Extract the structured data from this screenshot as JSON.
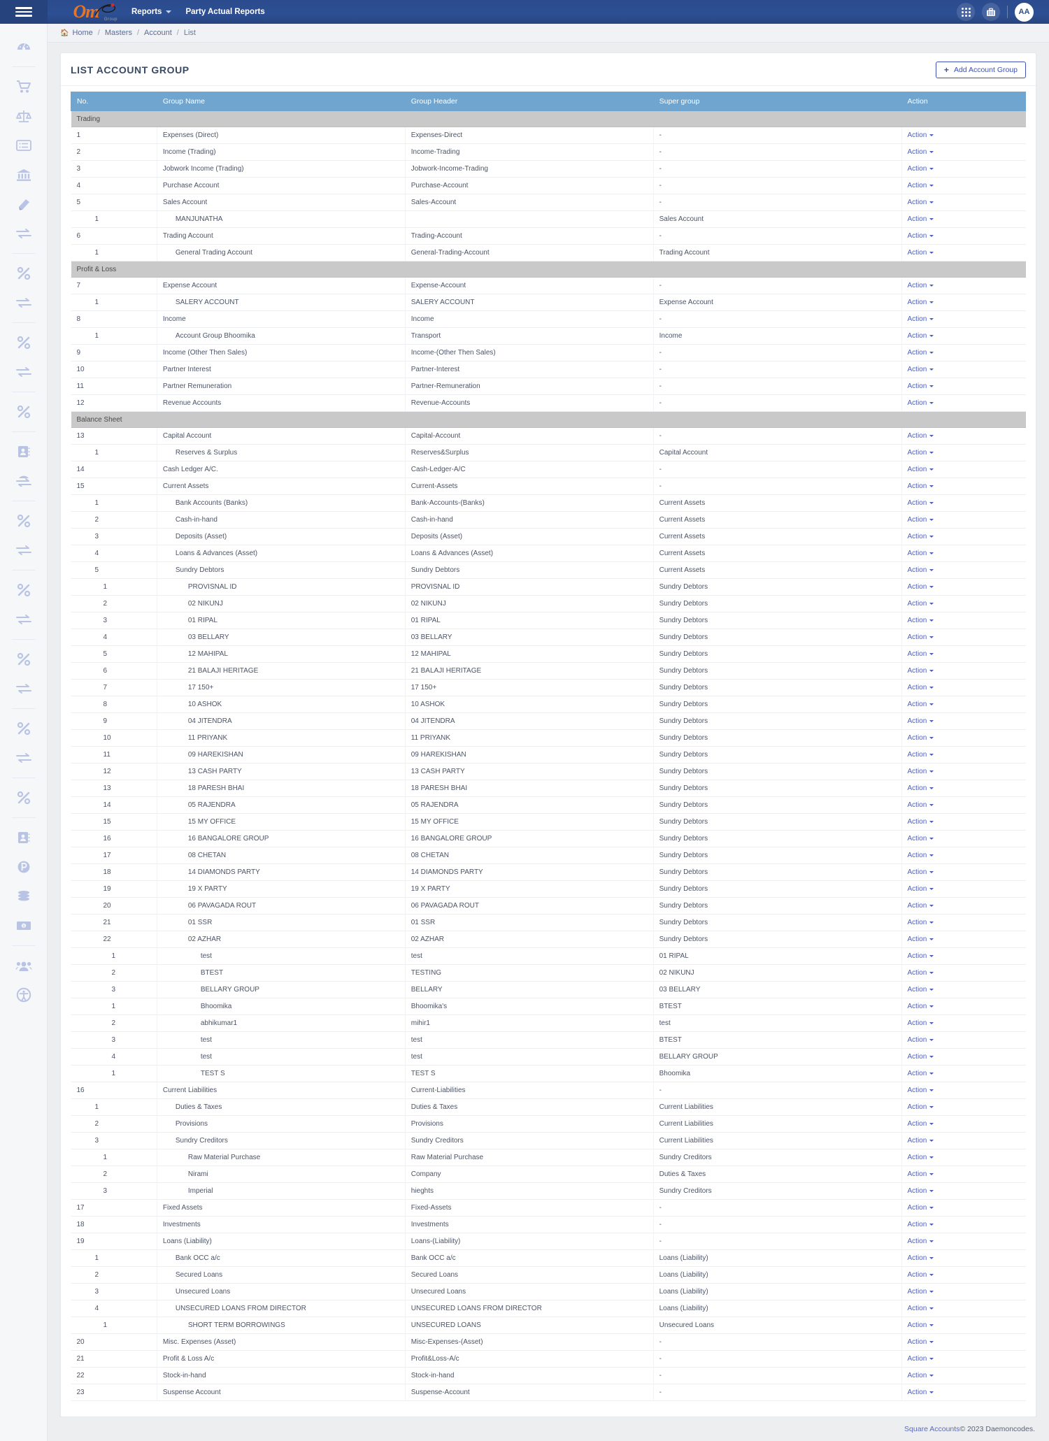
{
  "topbar": {
    "menu_icon": "hamburger-icon",
    "logo_text": "Om",
    "logo_sub": "Group",
    "nav": [
      {
        "label": "Reports",
        "has_caret": true
      },
      {
        "label": "Party Actual Reports",
        "has_caret": false
      }
    ],
    "icons": [
      "apps-grid-icon",
      "briefcase-icon"
    ],
    "avatar_initials": "AA"
  },
  "breadcrumb": {
    "home": "Home",
    "items": [
      "Masters",
      "Account",
      "List"
    ],
    "separator": "/"
  },
  "card": {
    "title": "LIST ACCOUNT GROUP",
    "add_button": "Add Account Group",
    "add_button_icon": "plus-icon"
  },
  "table": {
    "columns": [
      "No.",
      "Group Name",
      "Group Header",
      "Super group",
      "Action"
    ],
    "action_label": "Action",
    "empty_value": "-",
    "rows": [
      {
        "type": "section",
        "label": "Trading"
      },
      {
        "no": "1",
        "level": 0,
        "name": "Expenses (Direct)",
        "header": "Expenses-Direct",
        "super": "-"
      },
      {
        "no": "2",
        "level": 0,
        "name": "Income (Trading)",
        "header": "Income-Trading",
        "super": "-"
      },
      {
        "no": "3",
        "level": 0,
        "name": "Jobwork Income (Trading)",
        "header": "Jobwork-Income-Trading",
        "super": "-"
      },
      {
        "no": "4",
        "level": 0,
        "name": "Purchase Account",
        "header": "Purchase-Account",
        "super": "-"
      },
      {
        "no": "5",
        "level": 0,
        "name": "Sales Account",
        "header": "Sales-Account",
        "super": "-"
      },
      {
        "no": "1",
        "level": 1,
        "name": "MANJUNATHA",
        "header": "",
        "super": "Sales Account"
      },
      {
        "no": "6",
        "level": 0,
        "name": "Trading Account",
        "header": "Trading-Account",
        "super": "-"
      },
      {
        "no": "1",
        "level": 1,
        "name": "General Trading Account",
        "header": "General-Trading-Account",
        "super": "Trading Account"
      },
      {
        "type": "section",
        "label": "Profit & Loss"
      },
      {
        "no": "7",
        "level": 0,
        "name": "Expense Account",
        "header": "Expense-Account",
        "super": "-"
      },
      {
        "no": "1",
        "level": 1,
        "name": "SALERY ACCOUNT",
        "header": "SALERY ACCOUNT",
        "super": "Expense Account"
      },
      {
        "no": "8",
        "level": 0,
        "name": "Income",
        "header": "Income",
        "super": "-"
      },
      {
        "no": "1",
        "level": 1,
        "name": "Account Group Bhoomika",
        "header": "Transport",
        "super": "Income"
      },
      {
        "no": "9",
        "level": 0,
        "name": "Income (Other Then Sales)",
        "header": "Income-(Other Then Sales)",
        "super": "-"
      },
      {
        "no": "10",
        "level": 0,
        "name": "Partner Interest",
        "header": "Partner-Interest",
        "super": "-"
      },
      {
        "no": "11",
        "level": 0,
        "name": "Partner Remuneration",
        "header": "Partner-Remuneration",
        "super": "-"
      },
      {
        "no": "12",
        "level": 0,
        "name": "Revenue Accounts",
        "header": "Revenue-Accounts",
        "super": "-"
      },
      {
        "type": "section",
        "label": "Balance Sheet"
      },
      {
        "no": "13",
        "level": 0,
        "name": "Capital Account",
        "header": "Capital-Account",
        "super": "-"
      },
      {
        "no": "1",
        "level": 1,
        "name": "Reserves & Surplus",
        "header": "Reserves&Surplus",
        "super": "Capital Account"
      },
      {
        "no": "14",
        "level": 0,
        "name": "Cash Ledger A/C.",
        "header": "Cash-Ledger-A/C",
        "super": "-"
      },
      {
        "no": "15",
        "level": 0,
        "name": "Current Assets",
        "header": "Current-Assets",
        "super": "-"
      },
      {
        "no": "1",
        "level": 1,
        "name": "Bank Accounts (Banks)",
        "header": "Bank-Accounts-(Banks)",
        "super": "Current Assets"
      },
      {
        "no": "2",
        "level": 1,
        "name": "Cash-in-hand",
        "header": "Cash-in-hand",
        "super": "Current Assets"
      },
      {
        "no": "3",
        "level": 1,
        "name": "Deposits (Asset)",
        "header": "Deposits (Asset)",
        "super": "Current Assets"
      },
      {
        "no": "4",
        "level": 1,
        "name": "Loans & Advances (Asset)",
        "header": "Loans & Advances (Asset)",
        "super": "Current Assets"
      },
      {
        "no": "5",
        "level": 1,
        "name": "Sundry Debtors",
        "header": "Sundry Debtors",
        "super": "Current Assets"
      },
      {
        "no": "1",
        "level": 2,
        "name": "PROVISNAL ID",
        "header": "PROVISNAL ID",
        "super": "Sundry Debtors"
      },
      {
        "no": "2",
        "level": 2,
        "name": "02 NIKUNJ",
        "header": "02 NIKUNJ",
        "super": "Sundry Debtors"
      },
      {
        "no": "3",
        "level": 2,
        "name": "01 RIPAL",
        "header": "01 RIPAL",
        "super": "Sundry Debtors"
      },
      {
        "no": "4",
        "level": 2,
        "name": "03 BELLARY",
        "header": "03 BELLARY",
        "super": "Sundry Debtors"
      },
      {
        "no": "5",
        "level": 2,
        "name": "12 MAHIPAL",
        "header": "12 MAHIPAL",
        "super": "Sundry Debtors"
      },
      {
        "no": "6",
        "level": 2,
        "name": "21 BALAJI HERITAGE",
        "header": "21 BALAJI HERITAGE",
        "super": "Sundry Debtors"
      },
      {
        "no": "7",
        "level": 2,
        "name": "17 150+",
        "header": "17 150+",
        "super": "Sundry Debtors"
      },
      {
        "no": "8",
        "level": 2,
        "name": "10 ASHOK",
        "header": "10 ASHOK",
        "super": "Sundry Debtors"
      },
      {
        "no": "9",
        "level": 2,
        "name": "04 JITENDRA",
        "header": "04 JITENDRA",
        "super": "Sundry Debtors"
      },
      {
        "no": "10",
        "level": 2,
        "name": "11 PRIYANK",
        "header": "11 PRIYANK",
        "super": "Sundry Debtors"
      },
      {
        "no": "11",
        "level": 2,
        "name": "09 HAREKISHAN",
        "header": "09 HAREKISHAN",
        "super": "Sundry Debtors"
      },
      {
        "no": "12",
        "level": 2,
        "name": "13 CASH PARTY",
        "header": "13 CASH PARTY",
        "super": "Sundry Debtors"
      },
      {
        "no": "13",
        "level": 2,
        "name": "18 PARESH BHAI",
        "header": "18 PARESH BHAI",
        "super": "Sundry Debtors"
      },
      {
        "no": "14",
        "level": 2,
        "name": "05 RAJENDRA",
        "header": "05 RAJENDRA",
        "super": "Sundry Debtors"
      },
      {
        "no": "15",
        "level": 2,
        "name": "15 MY OFFICE",
        "header": "15 MY OFFICE",
        "super": "Sundry Debtors"
      },
      {
        "no": "16",
        "level": 2,
        "name": "16 BANGALORE GROUP",
        "header": "16 BANGALORE GROUP",
        "super": "Sundry Debtors"
      },
      {
        "no": "17",
        "level": 2,
        "name": "08 CHETAN",
        "header": "08 CHETAN",
        "super": "Sundry Debtors"
      },
      {
        "no": "18",
        "level": 2,
        "name": "14 DIAMONDS PARTY",
        "header": "14 DIAMONDS PARTY",
        "super": "Sundry Debtors"
      },
      {
        "no": "19",
        "level": 2,
        "name": "19 X PARTY",
        "header": "19 X PARTY",
        "super": "Sundry Debtors"
      },
      {
        "no": "20",
        "level": 2,
        "name": "06 PAVAGADA ROUT",
        "header": "06 PAVAGADA ROUT",
        "super": "Sundry Debtors"
      },
      {
        "no": "21",
        "level": 2,
        "name": "01 SSR",
        "header": "01 SSR",
        "super": "Sundry Debtors"
      },
      {
        "no": "22",
        "level": 2,
        "name": "02 AZHAR",
        "header": "02 AZHAR",
        "super": "Sundry Debtors"
      },
      {
        "no": "1",
        "level": 3,
        "name": "test",
        "header": "test",
        "super": "01 RIPAL"
      },
      {
        "no": "2",
        "level": 3,
        "name": "BTEST",
        "header": "TESTING",
        "super": "02 NIKUNJ"
      },
      {
        "no": "3",
        "level": 3,
        "name": "BELLARY GROUP",
        "header": "BELLARY",
        "super": "03 BELLARY"
      },
      {
        "no": "1",
        "level": 3,
        "name": "Bhoomika",
        "header": "Bhoomika's",
        "super": "BTEST"
      },
      {
        "no": "2",
        "level": 3,
        "name": "abhikumar1",
        "header": "mihir1",
        "super": "test"
      },
      {
        "no": "3",
        "level": 3,
        "name": "test",
        "header": "test",
        "super": "BTEST"
      },
      {
        "no": "4",
        "level": 3,
        "name": "test",
        "header": "test",
        "super": "BELLARY GROUP"
      },
      {
        "no": "1",
        "level": 3,
        "name": "TEST S",
        "header": "TEST S",
        "super": "Bhoomika"
      },
      {
        "no": "16",
        "level": 0,
        "name": "Current Liabilities",
        "header": "Current-Liabilities",
        "super": "-"
      },
      {
        "no": "1",
        "level": 1,
        "name": "Duties & Taxes",
        "header": "Duties & Taxes",
        "super": "Current Liabilities"
      },
      {
        "no": "2",
        "level": 1,
        "name": "Provisions",
        "header": "Provisions",
        "super": "Current Liabilities"
      },
      {
        "no": "3",
        "level": 1,
        "name": "Sundry Creditors",
        "header": "Sundry Creditors",
        "super": "Current Liabilities"
      },
      {
        "no": "1",
        "level": 2,
        "name": "Raw Material Purchase",
        "header": "Raw Material Purchase",
        "super": "Sundry Creditors"
      },
      {
        "no": "2",
        "level": 2,
        "name": "Nirami",
        "header": "Company",
        "super": "Duties & Taxes"
      },
      {
        "no": "3",
        "level": 2,
        "name": "Imperial",
        "header": "hieghts",
        "super": "Sundry Creditors"
      },
      {
        "no": "17",
        "level": 0,
        "name": "Fixed Assets",
        "header": "Fixed-Assets",
        "super": "-"
      },
      {
        "no": "18",
        "level": 0,
        "name": "Investments",
        "header": "Investments",
        "super": "-"
      },
      {
        "no": "19",
        "level": 0,
        "name": "Loans (Liability)",
        "header": "Loans-(Liability)",
        "super": "-"
      },
      {
        "no": "1",
        "level": 1,
        "name": "Bank OCC a/c",
        "header": "Bank OCC a/c",
        "super": "Loans (Liability)"
      },
      {
        "no": "2",
        "level": 1,
        "name": "Secured Loans",
        "header": "Secured Loans",
        "super": "Loans (Liability)"
      },
      {
        "no": "3",
        "level": 1,
        "name": "Unsecured Loans",
        "header": "Unsecured Loans",
        "super": "Loans (Liability)"
      },
      {
        "no": "4",
        "level": 1,
        "name": "UNSECURED LOANS FROM DIRECTOR",
        "header": "UNSECURED LOANS FROM DIRECTOR",
        "super": "Loans (Liability)"
      },
      {
        "no": "1",
        "level": 2,
        "name": "SHORT TERM BORROWINGS",
        "header": "UNSECURED LOANS",
        "super": "Unsecured Loans"
      },
      {
        "no": "20",
        "level": 0,
        "name": "Misc. Expenses (Asset)",
        "header": "Misc-Expenses-(Asset)",
        "super": "-"
      },
      {
        "no": "21",
        "level": 0,
        "name": "Profit & Loss A/c",
        "header": "Profit&Loss-A/c",
        "super": "-"
      },
      {
        "no": "22",
        "level": 0,
        "name": "Stock-in-hand",
        "header": "Stock-in-hand",
        "super": "-"
      },
      {
        "no": "23",
        "level": 0,
        "name": "Suspense Account",
        "header": "Suspense-Account",
        "super": "-"
      }
    ]
  },
  "sidebar": {
    "items": [
      {
        "icon": "dashboard-icon",
        "divider_after": true
      },
      {
        "icon": "shopping-cart-icon"
      },
      {
        "icon": "scales-balance-icon"
      },
      {
        "icon": "list-card-icon"
      },
      {
        "icon": "bank-icon"
      },
      {
        "icon": "book-icon"
      },
      {
        "icon": "transfer-arrows-icon",
        "divider_after": true
      },
      {
        "icon": "percent-icon"
      },
      {
        "icon": "transfer-arrows-icon",
        "divider_after": true
      },
      {
        "icon": "percent-icon"
      },
      {
        "icon": "transfer-arrows-icon",
        "divider_after": true
      },
      {
        "icon": "percent-icon",
        "divider_after": true
      },
      {
        "icon": "contact-book-icon"
      },
      {
        "icon": "transfer-arrows-icon",
        "divider_after": true
      },
      {
        "icon": "percent-icon"
      },
      {
        "icon": "transfer-arrows-icon",
        "divider_after": true
      },
      {
        "icon": "percent-icon"
      },
      {
        "icon": "transfer-arrows-icon",
        "divider_after": true
      },
      {
        "icon": "percent-icon"
      },
      {
        "icon": "transfer-arrows-icon",
        "divider_after": true
      },
      {
        "icon": "percent-icon"
      },
      {
        "icon": "transfer-arrows-icon",
        "divider_after": true
      },
      {
        "icon": "percent-icon",
        "divider_after": true
      },
      {
        "icon": "contact-book-icon"
      },
      {
        "icon": "parking-p-icon"
      },
      {
        "icon": "coins-stack-icon"
      },
      {
        "icon": "banknote-icon",
        "divider_after": true
      },
      {
        "icon": "users-group-icon"
      },
      {
        "icon": "accessibility-icon"
      }
    ]
  },
  "footer": {
    "brand": "Square Accounts",
    "copy": "© 2023 Daemoncodes."
  },
  "colors": {
    "nav_blue": "#2d4f93",
    "table_header": "#6fa5cf",
    "section_gray": "#c9c9c9",
    "action_link": "#4a5ec4",
    "accent_orange": "#e8742a"
  }
}
